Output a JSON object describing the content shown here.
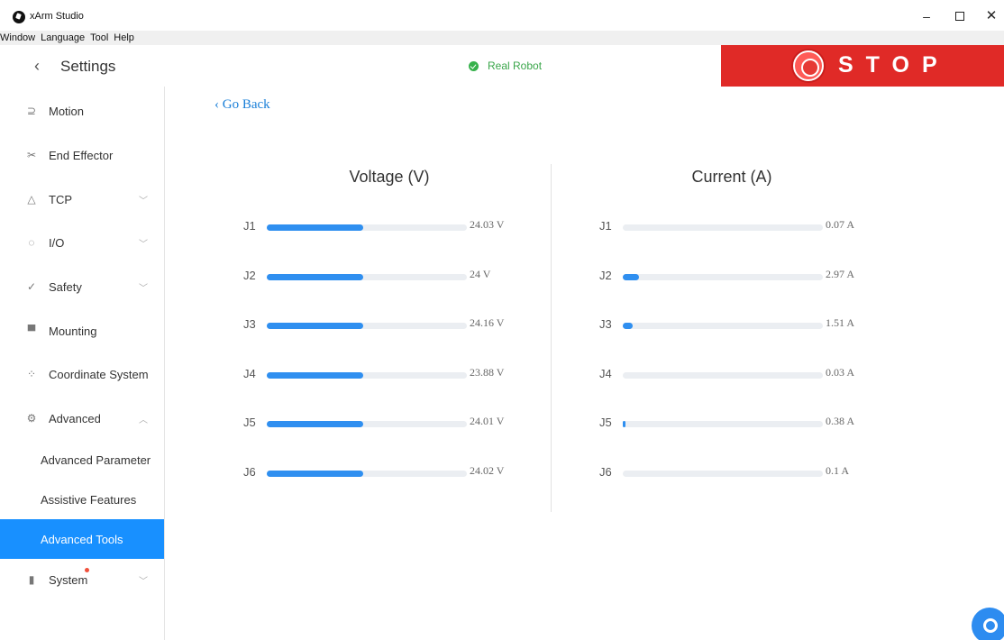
{
  "window": {
    "title": "xArm Studio",
    "minimize": "–",
    "close": "✕"
  },
  "menu": [
    "Window",
    "Language",
    "Tool",
    "Help"
  ],
  "header": {
    "back": "‹",
    "title": "Settings",
    "status": "Real Robot",
    "stop": "STOP"
  },
  "sidebar": {
    "items": [
      {
        "label": "Motion",
        "icon": "motion-icon",
        "glyph": "⊇"
      },
      {
        "label": "End Effector",
        "icon": "end-effector-icon",
        "glyph": "✂"
      },
      {
        "label": "TCP",
        "icon": "tcp-icon",
        "glyph": "△",
        "chevron": "﹀"
      },
      {
        "label": "I/O",
        "icon": "io-icon",
        "glyph": "◌",
        "chevron": "﹀"
      },
      {
        "label": "Safety",
        "icon": "safety-icon",
        "glyph": "✓",
        "chevron": "﹀"
      },
      {
        "label": "Mounting",
        "icon": "mounting-icon",
        "glyph": "▀"
      },
      {
        "label": "Coordinate System",
        "icon": "coordinate-icon",
        "glyph": "⁘"
      },
      {
        "label": "Advanced",
        "icon": "advanced-icon",
        "glyph": "⚙",
        "chevron": "︿"
      }
    ],
    "sub": [
      "Advanced Parameter",
      "Assistive Features",
      "Advanced Tools"
    ],
    "system": {
      "label": "System",
      "icon": "system-icon",
      "glyph": "▮",
      "chevron": "﹀"
    }
  },
  "main": {
    "go_back": "‹ Go Back",
    "voltage_title": "Voltage (V)",
    "current_title": "Current (A)",
    "voltage": [
      {
        "joint": "J1",
        "value": "24.03 V",
        "level": 0.48
      },
      {
        "joint": "J2",
        "value": "24 V",
        "level": 0.48
      },
      {
        "joint": "J3",
        "value": "24.16 V",
        "level": 0.48
      },
      {
        "joint": "J4",
        "value": "23.88 V",
        "level": 0.48
      },
      {
        "joint": "J5",
        "value": "24.01 V",
        "level": 0.48
      },
      {
        "joint": "J6",
        "value": "24.02 V",
        "level": 0.48
      }
    ],
    "current": [
      {
        "joint": "J1",
        "value": "0.07 A",
        "level": 0.0
      },
      {
        "joint": "J2",
        "value": "2.97 A",
        "level": 0.08
      },
      {
        "joint": "J3",
        "value": "1.51 A",
        "level": 0.05
      },
      {
        "joint": "J4",
        "value": "0.03 A",
        "level": 0.0
      },
      {
        "joint": "J5",
        "value": "0.38 A",
        "level": 0.01
      },
      {
        "joint": "J6",
        "value": "0.1 A",
        "level": 0.0
      }
    ]
  },
  "colors": {
    "accent": "#1890ff",
    "stop": "#e02a27",
    "status": "#36b14b",
    "bar": "#2f8ff0"
  }
}
